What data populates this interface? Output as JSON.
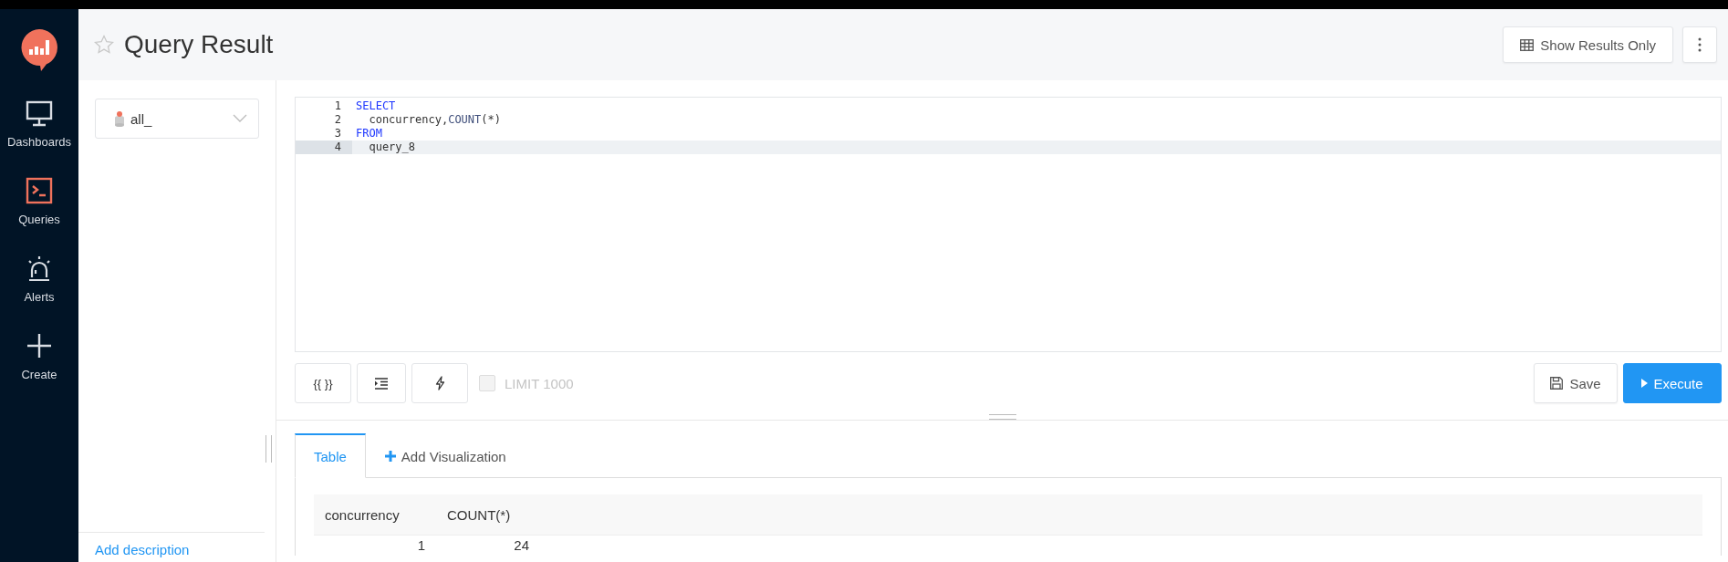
{
  "sidebar": {
    "items": [
      {
        "label": "Dashboards",
        "selected": false
      },
      {
        "label": "Queries",
        "selected": true
      },
      {
        "label": "Alerts",
        "selected": false
      },
      {
        "label": "Create",
        "selected": false
      }
    ]
  },
  "header": {
    "title": "Query Result",
    "starred": false,
    "show_results_button": "Show Results Only"
  },
  "data_source": {
    "value": "all_"
  },
  "description_link": "Add description",
  "editor": {
    "lines": [
      {
        "number": "1",
        "current": false,
        "tokens": [
          {
            "text": "SELECT",
            "kind": "keyword"
          }
        ]
      },
      {
        "number": "2",
        "current": false,
        "tokens": [
          {
            "text": "  concurrency,",
            "kind": "plain"
          },
          {
            "text": "COUNT",
            "kind": "function"
          },
          {
            "text": "(*)",
            "kind": "plain"
          }
        ]
      },
      {
        "number": "3",
        "current": false,
        "tokens": [
          {
            "text": "FROM",
            "kind": "keyword"
          }
        ]
      },
      {
        "number": "4",
        "current": true,
        "tokens": [
          {
            "text": "  query_8",
            "kind": "plain"
          }
        ]
      }
    ]
  },
  "toolbar": {
    "params_button": "{{ }}",
    "limit": {
      "label": "LIMIT 1000",
      "checked": false,
      "disabled": true
    },
    "save_button": "Save",
    "execute_button": "Execute"
  },
  "tabs": [
    {
      "label": "Table",
      "kind": "tab",
      "selected": true
    },
    {
      "label": "Add Visualization",
      "kind": "add",
      "selected": false
    }
  ],
  "table": {
    "columns": [
      "concurrency",
      "COUNT(*)"
    ],
    "rows": [
      [
        "1",
        "24"
      ]
    ]
  }
}
